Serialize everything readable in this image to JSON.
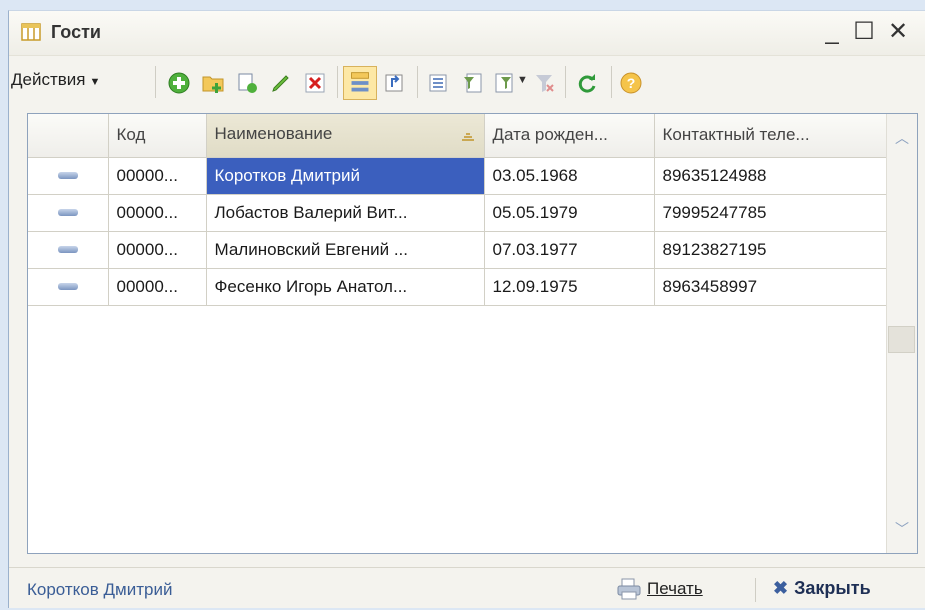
{
  "window": {
    "title": "Гости",
    "min_symbol": "_",
    "max_symbol": "☐",
    "close_symbol": "✕"
  },
  "toolbar": {
    "actions_label": "Действия",
    "icons": [
      "add-icon",
      "add-folder-icon",
      "copy-icon",
      "edit-icon",
      "delete-icon",
      "hierarchy-view-icon",
      "level-up-icon",
      "filter-settings-icon",
      "filter-by-value-icon",
      "filter-list-icon",
      "clear-filter-icon",
      "refresh-icon",
      "help-icon"
    ]
  },
  "table": {
    "columns": [
      "",
      "Код",
      "Наименование",
      "Дата рожден...",
      "Контактный теле..."
    ],
    "rows": [
      {
        "code": "00000...",
        "name": "Коротков Дмитрий",
        "birth": "03.05.1968",
        "phone": "89635124988"
      },
      {
        "code": "00000...",
        "name": "Лобастов Валерий Вит...",
        "birth": "05.05.1979",
        "phone": "79995247785"
      },
      {
        "code": "00000...",
        "name": "Малиновский Евгений ...",
        "birth": "07.03.1977",
        "phone": "89123827195"
      },
      {
        "code": "00000...",
        "name": "Фесенко Игорь Анатол...",
        "birth": "12.09.1975",
        "phone": "8963458997"
      }
    ],
    "selected_row": 0,
    "sorted_column": "Наименование"
  },
  "status": {
    "current": "Коротков Дмитрий"
  },
  "buttons": {
    "print": "Печать",
    "close": "Закрыть"
  },
  "colors": {
    "selection": "#3b5fbe",
    "link": "#3a5d96"
  }
}
